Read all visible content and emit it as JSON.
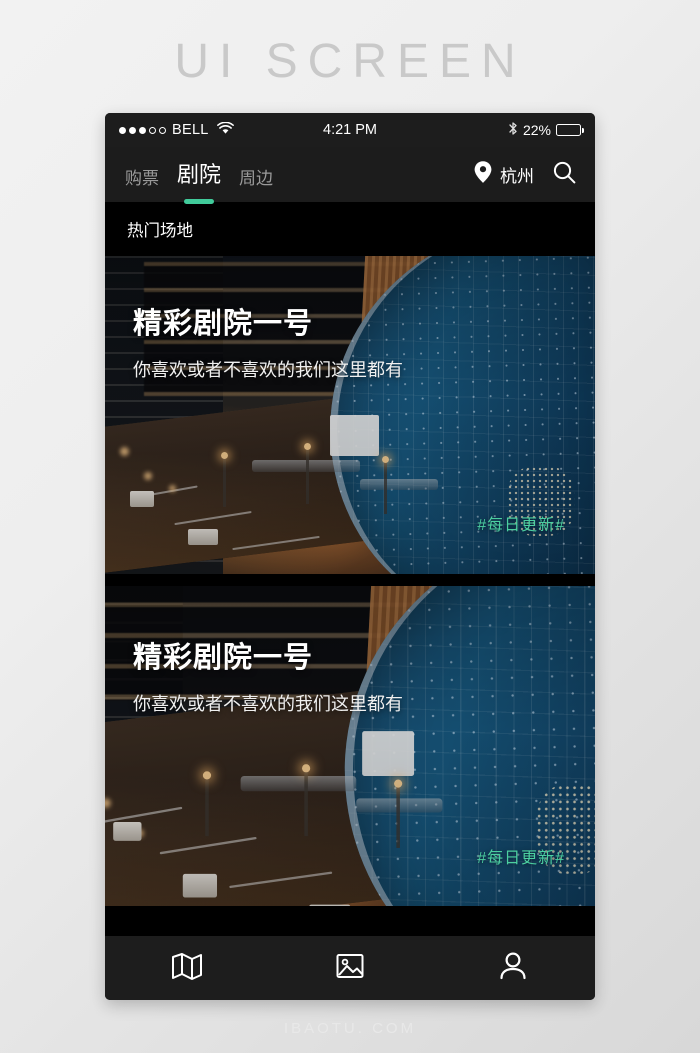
{
  "watermarks": {
    "top": "UI SCREEN",
    "bottom": "IBAOTU. COM"
  },
  "theme": {
    "accent_green": "#41cb9b",
    "tag_green": "#4ccfa0",
    "navbar_bg": "#1c1c1c",
    "page_bg": "#000000"
  },
  "status_bar": {
    "carrier": "BELL",
    "signal_dots_filled": 3,
    "signal_dots_total": 5,
    "wifi_icon": "wifi-icon",
    "time": "4:21 PM",
    "bluetooth_icon": "bluetooth-icon",
    "battery_percent": "22%",
    "battery_level": 22
  },
  "navbar": {
    "tabs": [
      {
        "label": "购票",
        "active": false
      },
      {
        "label": "剧院",
        "active": true
      },
      {
        "label": "周边",
        "active": false
      }
    ],
    "location": {
      "icon": "location-pin-icon",
      "city": "杭州"
    },
    "search_icon": "search-icon"
  },
  "section": {
    "title": "热门场地"
  },
  "cards": [
    {
      "title": "精彩剧院一号",
      "subtitle": "你喜欢或者不喜欢的我们这里都有",
      "tag": "#每日更新#"
    },
    {
      "title": "精彩剧院一号",
      "subtitle": "你喜欢或者不喜欢的我们这里都有",
      "tag": "#每日更新#"
    }
  ],
  "bottom_nav": [
    {
      "icon": "map-icon",
      "label": ""
    },
    {
      "icon": "image-icon",
      "label": ""
    },
    {
      "icon": "user-icon",
      "label": ""
    }
  ]
}
